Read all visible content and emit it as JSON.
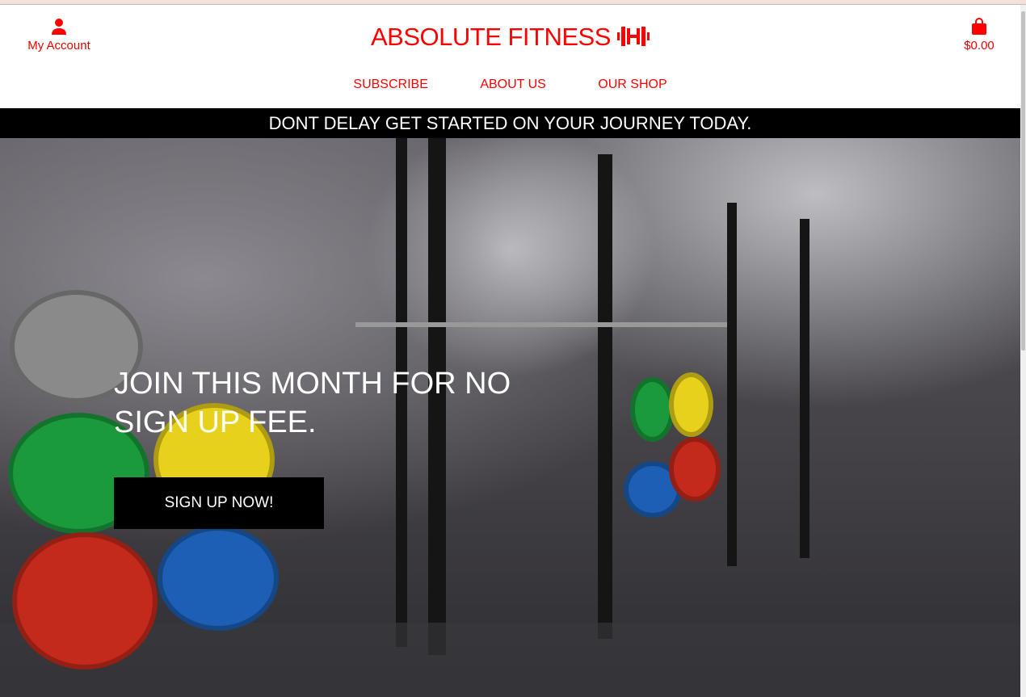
{
  "header": {
    "account_label": "My Account",
    "logo_text": "ABSOLUTE FITNESS",
    "cart_total": "$0.00"
  },
  "nav": [
    {
      "label": "SUBSCRIBE"
    },
    {
      "label": "ABOUT US"
    },
    {
      "label": "OUR SHOP"
    }
  ],
  "banner": "DONT DELAY GET STARTED ON YOUR JOURNEY TODAY.",
  "hero": {
    "heading": "JOIN THIS MONTH FOR NO SIGN UP FEE.",
    "button_label": "SIGN UP NOW!"
  },
  "colors": {
    "brand": "#ff0000",
    "banner_bg": "#000000"
  }
}
